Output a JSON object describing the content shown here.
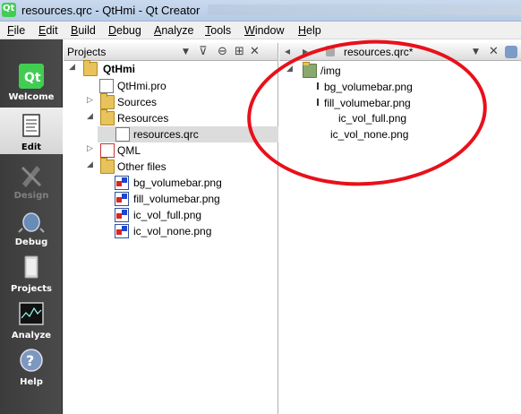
{
  "window": {
    "title": "resources.qrc - QtHmi - Qt Creator"
  },
  "menu": {
    "items": [
      {
        "ul": "F",
        "rest": "ile"
      },
      {
        "ul": "E",
        "rest": "dit"
      },
      {
        "ul": "B",
        "rest": "uild"
      },
      {
        "ul": "D",
        "rest": "ebug"
      },
      {
        "ul": "A",
        "rest": "nalyze"
      },
      {
        "ul": "T",
        "rest": "ools"
      },
      {
        "ul": "W",
        "rest": "indow"
      },
      {
        "ul": "H",
        "rest": "elp"
      }
    ]
  },
  "modes": [
    {
      "label": "Welcome",
      "icon": "qt-logo-icon",
      "state": "normal"
    },
    {
      "label": "Edit",
      "icon": "edit-document-icon",
      "state": "active"
    },
    {
      "label": "Design",
      "icon": "design-pen-icon",
      "state": "disabled"
    },
    {
      "label": "Debug",
      "icon": "debug-bug-icon",
      "state": "normal"
    },
    {
      "label": "Projects",
      "icon": "projects-wrench-icon",
      "state": "normal"
    },
    {
      "label": "Analyze",
      "icon": "analyze-monitor-icon",
      "state": "normal"
    },
    {
      "label": "Help",
      "icon": "help-question-icon",
      "state": "normal"
    }
  ],
  "projects_pane": {
    "title": "Projects",
    "tree": {
      "root": "QtHmi",
      "pro_file": "QtHmi.pro",
      "sources": "Sources",
      "resources": "Resources",
      "qrc_file": "resources.qrc",
      "qml": "QML",
      "other_files": "Other files",
      "images": [
        "bg_volumebar.png",
        "fill_volumebar.png",
        "ic_vol_full.png",
        "ic_vol_none.png"
      ]
    }
  },
  "editor": {
    "tab_label": "resources.qrc*",
    "prefix": "/img",
    "files": [
      "bg_volumebar.png",
      "fill_volumebar.png",
      "ic_vol_full.png",
      "ic_vol_none.png"
    ]
  },
  "annotation_color": "#e8101a"
}
